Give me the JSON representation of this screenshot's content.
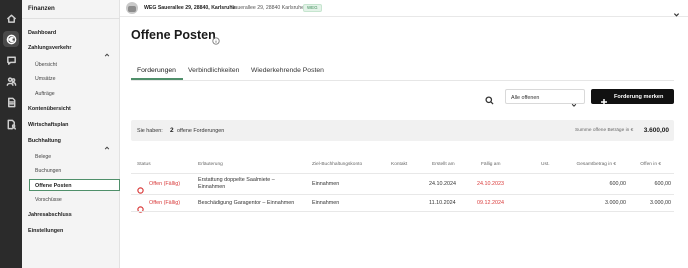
{
  "rail": {
    "icons": [
      "home-icon",
      "euro-icon",
      "chat-icon",
      "people-icon",
      "document-icon",
      "document-user-icon"
    ]
  },
  "sidebar": {
    "title": "Finanzen",
    "dashboard": "Dashboard",
    "zahlungsverkehr": {
      "label": "Zahlungsverkehr",
      "items": [
        "Übersicht",
        "Umsätze",
        "Aufträge"
      ]
    },
    "kontenuebersicht": "Kontenübersicht",
    "wirtschaftsplan": "Wirtschaftsplan",
    "buchhaltung": {
      "label": "Buchhaltung",
      "items": [
        "Belege",
        "Buchungen",
        "Offene Posten",
        "Vorschüsse"
      ],
      "active": "Offene Posten"
    },
    "jahresabschluss": "Jahresabschluss",
    "einstellungen": "Einstellungen"
  },
  "topbar": {
    "property_name": "WEG Sauerallee 29, 28840, Karlsruhe",
    "property_address": "Sauerallee 29, 28840 Karlsruhe",
    "badge": "WEG"
  },
  "page": {
    "title": "Offene Posten"
  },
  "tabs": [
    {
      "label": "Forderungen",
      "active": true
    },
    {
      "label": "Verbindlichkeiten",
      "active": false
    },
    {
      "label": "Wiederkehrende Posten",
      "active": false
    }
  ],
  "filter": {
    "selected": "Alle offenen"
  },
  "actions": {
    "add_label": "Forderung merken"
  },
  "summary": {
    "label": "Sie haben:",
    "count": "2",
    "text": "offene Forderungen",
    "sum_label": "Summe offene Beträge in €",
    "sum_value": "3.600,00"
  },
  "table": {
    "headers": [
      "Status",
      "Erläuterung",
      "Ziel-Buchhaltungskonto",
      "Kontakt",
      "Erstellt am",
      "Fällig am",
      "Ust.",
      "Gesamtbetrag in €",
      "Offen in €"
    ],
    "rows": [
      {
        "status": "Offen (Fällig)",
        "erlaeuterung_1": "Erstattung doppelte Saalmiete –",
        "erlaeuterung_2": "Einnahmen",
        "konto": "Einnahmen",
        "kontakt": "",
        "erstellt": "24.10.2024",
        "faellig": "24.10.2023",
        "ust": "",
        "gesamt": "600,00",
        "offen": "600,00"
      },
      {
        "status": "Offen (Fällig)",
        "erlaeuterung_1": "Beschädigung Garagentor – Einnahmen",
        "erlaeuterung_2": "",
        "konto": "Einnahmen",
        "kontakt": "",
        "erstellt": "11.10.2024",
        "faellig": "09.12.2024",
        "ust": "",
        "gesamt": "3.000,00",
        "offen": "3.000,00"
      }
    ]
  },
  "colors": {
    "accent": "#4f8f6a",
    "overdue": "#d93a3a",
    "rail": "#2b2b2b",
    "button": "#111111"
  }
}
